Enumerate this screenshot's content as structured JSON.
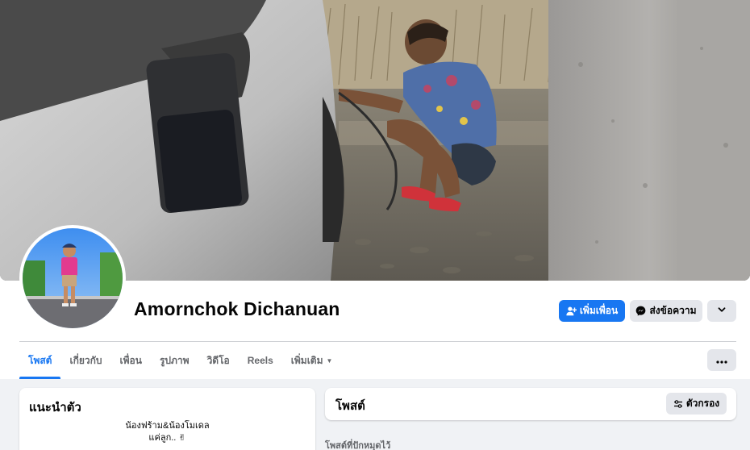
{
  "profile": {
    "name": "Amornchok Dichanuan"
  },
  "actions": {
    "add_friend": "เพิ่มเพื่อน",
    "message": "ส่งข้อความ"
  },
  "tabs": [
    {
      "label": "โพสต์"
    },
    {
      "label": "เกี่ยวกับ"
    },
    {
      "label": "เพื่อน"
    },
    {
      "label": "รูปภาพ"
    },
    {
      "label": "วิดีโอ"
    },
    {
      "label": "Reels"
    },
    {
      "label": "เพิ่มเติม"
    }
  ],
  "intro": {
    "title": "แนะนำตัว",
    "bio_line1": "น้องฟร้าม&น้องโมเดล",
    "bio_line2": "แค่ลูก.. ✌"
  },
  "posts": {
    "title": "โพสต์",
    "filter_label": "ตัวกรอง",
    "pinned_label": "โพสต์ที่ปักหมุดไว้"
  },
  "colors": {
    "accent": "#1877f2",
    "page_bg": "#f0f2f5",
    "button_secondary_bg": "#e4e6eb"
  },
  "icons": {
    "add_friend": "person-plus-icon",
    "message": "messenger-icon",
    "more": "chevron-down-icon",
    "tab_more": "caret-down-icon",
    "overflow": "ellipsis-icon",
    "filter": "sliders-icon"
  }
}
